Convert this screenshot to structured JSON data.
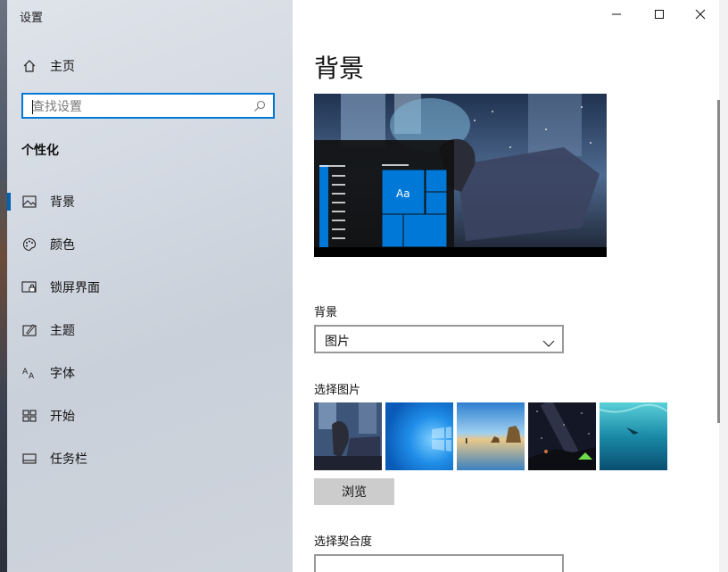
{
  "window": {
    "title": "设置"
  },
  "sidebar": {
    "home_label": "主页",
    "search_placeholder": "查找设置",
    "section": "个性化",
    "items": [
      {
        "label": "背景",
        "icon": "image-icon",
        "active": true
      },
      {
        "label": "颜色",
        "icon": "palette-icon"
      },
      {
        "label": "锁屏界面",
        "icon": "lock-screen-icon"
      },
      {
        "label": "主题",
        "icon": "theme-icon"
      },
      {
        "label": "字体",
        "icon": "font-icon"
      },
      {
        "label": "开始",
        "icon": "start-icon"
      },
      {
        "label": "任务栏",
        "icon": "taskbar-icon"
      }
    ]
  },
  "main": {
    "title": "背景",
    "preview_tile_text": "Aa",
    "background_label": "背景",
    "background_value": "图片",
    "choose_picture_label": "选择图片",
    "browse_label": "浏览",
    "fit_label": "选择契合度"
  },
  "colors": {
    "accent": "#0078d7",
    "accent_dark": "#0063b1"
  }
}
